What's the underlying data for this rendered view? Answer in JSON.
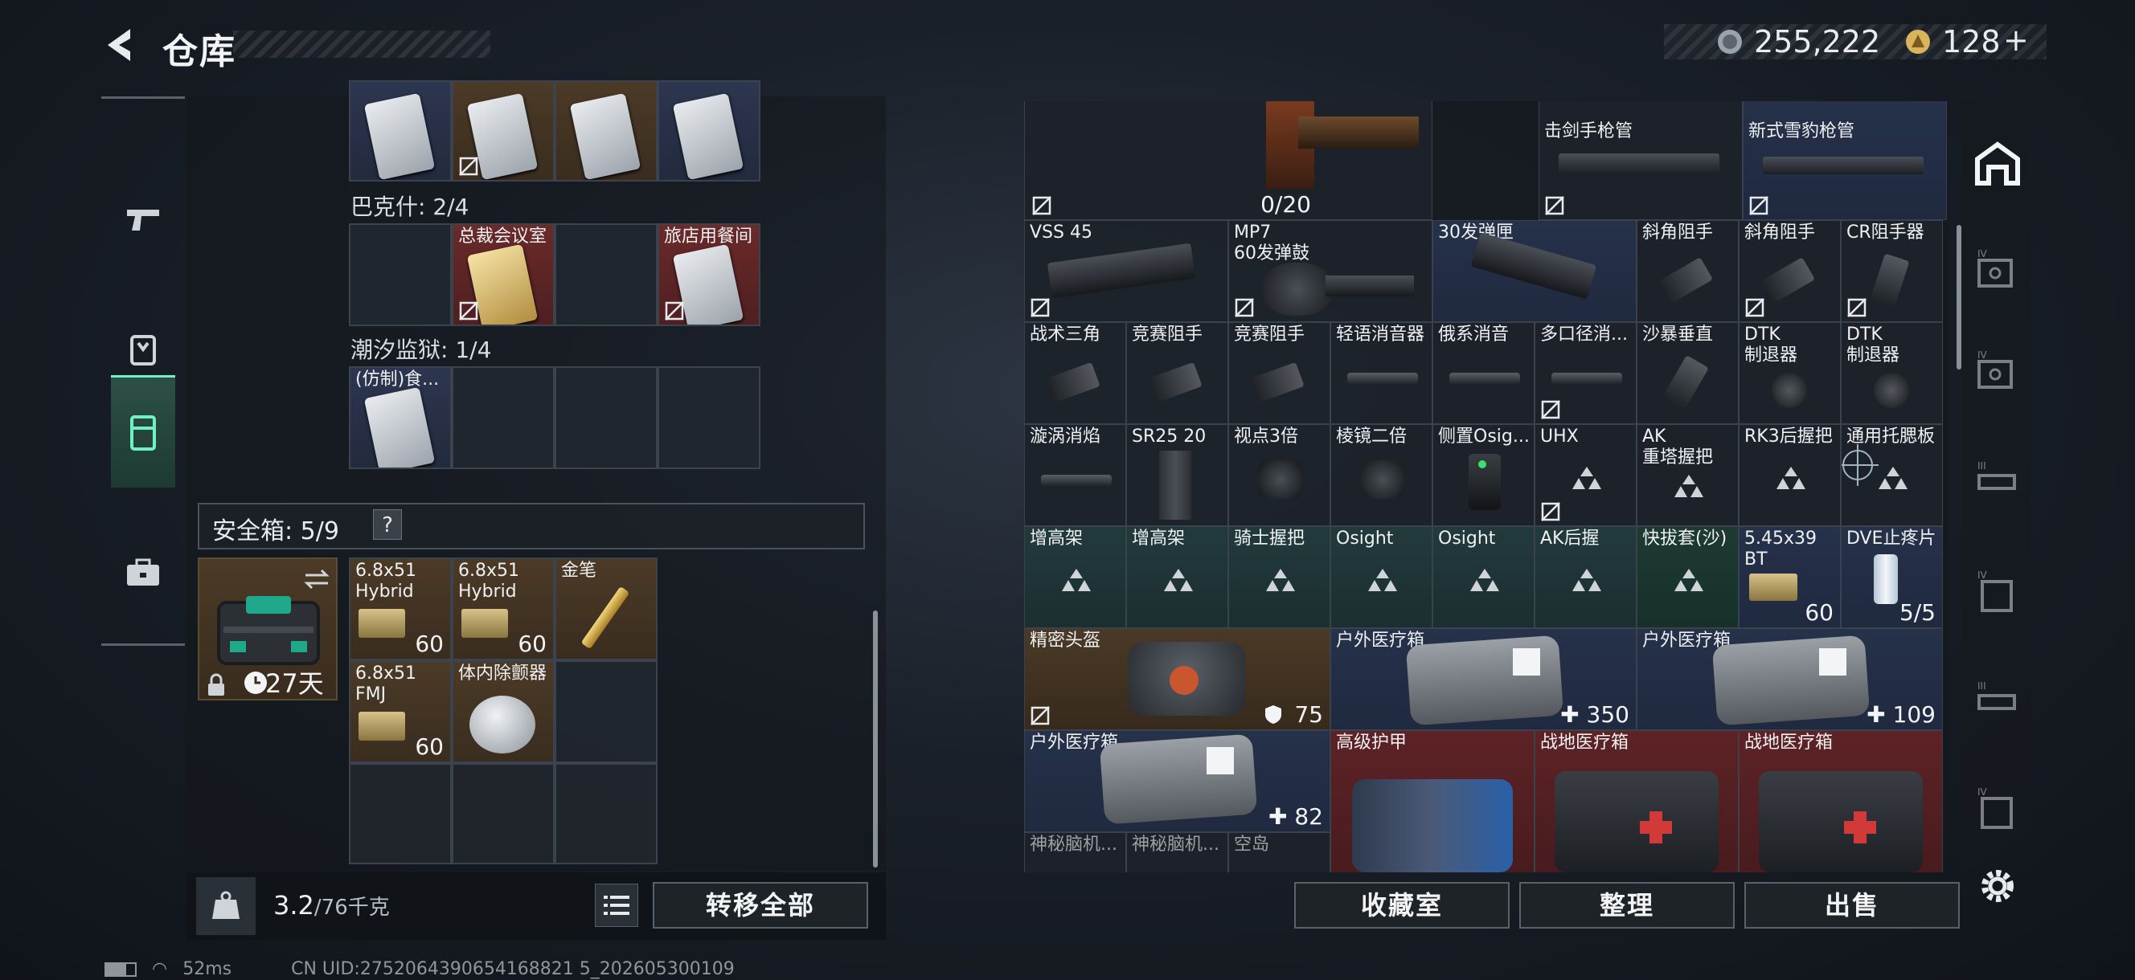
{
  "header": {
    "title": "仓库",
    "currency1": "255,222",
    "currency2": "128",
    "add_symbol": "+"
  },
  "left_nav": [
    "weapon-icon",
    "backpack-icon",
    "vest-icon",
    "briefcase-icon"
  ],
  "left_panel": {
    "row_top": [
      {
        "label": "",
        "bg": "blue"
      },
      {
        "label": "",
        "bg": "gold"
      },
      {
        "label": "",
        "bg": "gold"
      },
      {
        "label": "",
        "bg": "blue"
      }
    ],
    "section_bakesh": "巴克什: 2/4",
    "bakesh_items": [
      {
        "label": "",
        "bg": "empty"
      },
      {
        "label": "总裁会议室",
        "bg": "gold"
      },
      {
        "label": "",
        "bg": "empty"
      },
      {
        "label": "旅店用餐间",
        "bg": "red"
      }
    ],
    "section_prison": "潮汐监狱: 1/4",
    "prison_items": [
      {
        "label": "(仿制)食...",
        "bg": "blue"
      }
    ],
    "safebox_label": "安全箱: 5/9",
    "safebox_help": "?",
    "safebox_days": "27天",
    "safebox_items": [
      {
        "label": "6.8x51\nHybrid",
        "count": "60"
      },
      {
        "label": "6.8x51\nHybrid",
        "count": "60"
      },
      {
        "label": "金笔",
        "count": ""
      },
      {
        "label": "6.8x51\nFMJ",
        "count": "60"
      },
      {
        "label": "体内除颤器",
        "count": ""
      }
    ],
    "weight": "3.2",
    "weight_unit": "/76千克",
    "transfer_all": "转移全部"
  },
  "right_panel": {
    "row0": [
      {
        "label": "击剑手枪管"
      },
      {
        "label": "新式雪豹枪管"
      }
    ],
    "rifle_count": "0/20",
    "row1": [
      {
        "label": "VSS 45"
      },
      {
        "label": "MP7\n60发弹鼓"
      },
      {
        "label": "30发弹匣"
      },
      {
        "label": "斜角阻手"
      },
      {
        "label": "斜角阻手"
      },
      {
        "label": "CR阻手器"
      }
    ],
    "row2": [
      {
        "label": "战术三角"
      },
      {
        "label": "竞赛阻手"
      },
      {
        "label": "竞赛阻手"
      },
      {
        "label": "轻语消音器"
      },
      {
        "label": "俄系消音"
      },
      {
        "label": "多口径消..."
      },
      {
        "label": "沙暴垂直"
      },
      {
        "label": "DTK\n制退器"
      },
      {
        "label": "DTK\n制退器"
      }
    ],
    "row3": [
      {
        "label": "漩涡消焰"
      },
      {
        "label": "SR25 20"
      },
      {
        "label": "视点3倍"
      },
      {
        "label": "棱镜二倍"
      },
      {
        "label": "侧置Osig..."
      },
      {
        "label": "UHX"
      },
      {
        "label": "AK\n重塔握把"
      },
      {
        "label": "RK3后握把"
      },
      {
        "label": "通用托腮板"
      }
    ],
    "row4": [
      {
        "label": "增高架"
      },
      {
        "label": "增高架"
      },
      {
        "label": "骑士握把"
      },
      {
        "label": "Osight"
      },
      {
        "label": "Osight"
      },
      {
        "label": "AK后握"
      },
      {
        "label": "快拔套(沙)"
      },
      {
        "label": "5.45x39\nBT",
        "count": "60"
      },
      {
        "label": "DVE止疼片",
        "count": "5/5"
      }
    ],
    "row5": [
      {
        "label": "精密头盔",
        "count": "75"
      },
      {
        "label": "户外医疗箱",
        "count": "350"
      },
      {
        "label": "户外医疗箱",
        "count": "109"
      }
    ],
    "row6": [
      {
        "label": "户外医疗箱",
        "count": "82"
      },
      {
        "label": "高级护甲"
      },
      {
        "label": "战地医疗箱"
      },
      {
        "label": "战地医疗箱"
      }
    ],
    "row7": [
      {
        "label": "神秘脑机..."
      },
      {
        "label": "神秘脑机..."
      },
      {
        "label": "空岛"
      }
    ],
    "btn_collection": "收藏室",
    "btn_sort": "整理",
    "btn_sell": "出售"
  },
  "status": {
    "ping": "52ms",
    "uid": "CN UID:2752064390654168821 5_202605300109"
  },
  "colors": {
    "accent": "#6ef2c4",
    "gold_bg": "#4a3926",
    "red_bg": "#5d2326",
    "blue_bg": "#26324a"
  }
}
